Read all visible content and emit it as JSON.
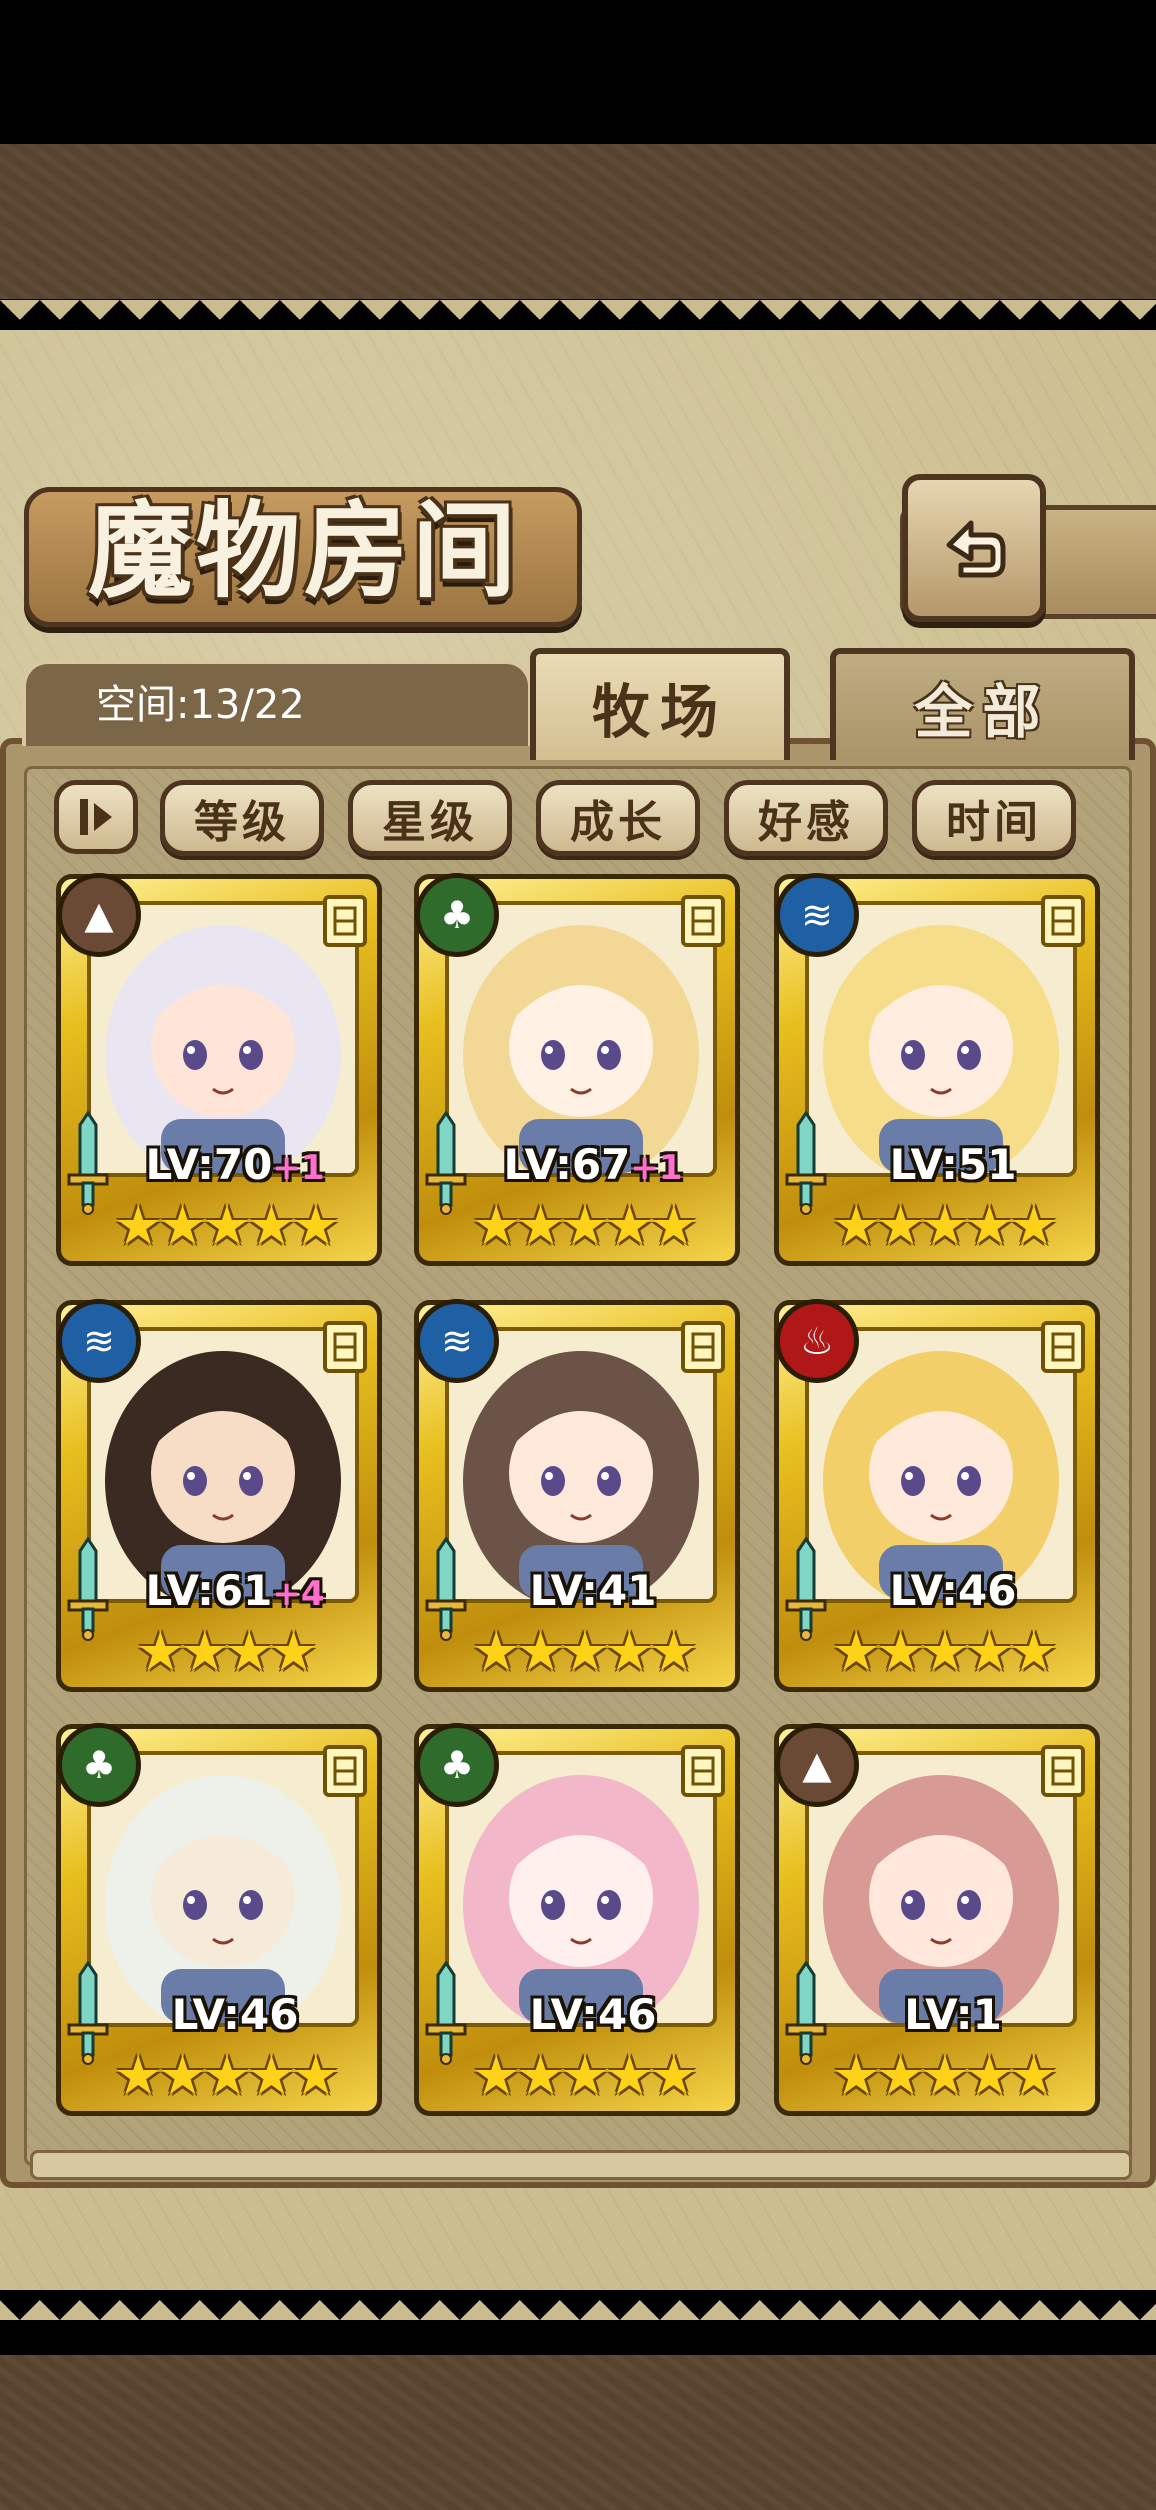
{
  "title": "魔物房间",
  "space_label": "空间:13/22",
  "tabs": [
    {
      "label": "牧场",
      "active": true
    },
    {
      "label": "全部",
      "active": false
    }
  ],
  "sort_buttons": [
    "等级",
    "星级",
    "成长",
    "好感",
    "时间"
  ],
  "colors": {
    "earth": "#6b4a35",
    "grass": "#2f6b2a",
    "water": "#1f5fa3",
    "fire": "#b01717"
  },
  "cards": [
    {
      "element": "earth",
      "level": "LV:70",
      "bonus": "+1",
      "stars": "★★★★★",
      "hair": "#e9e6f2",
      "skin": "#ffe5d8"
    },
    {
      "element": "grass",
      "level": "LV:67",
      "bonus": "+1",
      "stars": "★★★★★",
      "hair": "#f3d795",
      "skin": "#fff1e4"
    },
    {
      "element": "water",
      "level": "LV:51",
      "bonus": "",
      "stars": "★★★★★",
      "hair": "#f6dd8a",
      "skin": "#ffeee0"
    },
    {
      "element": "water",
      "level": "LV:61",
      "bonus": "+4",
      "stars": "★★★★",
      "hair": "#3b2a22",
      "skin": "#f7dcc6"
    },
    {
      "element": "water",
      "level": "LV:41",
      "bonus": "",
      "stars": "★★★★★",
      "hair": "#6b5447",
      "skin": "#ffe9da"
    },
    {
      "element": "fire",
      "level": "LV:46",
      "bonus": "",
      "stars": "★★★★★",
      "hair": "#f3cf6a",
      "skin": "#ffe9da"
    },
    {
      "element": "grass",
      "level": "LV:46",
      "bonus": "",
      "stars": "★★★★★",
      "hair": "#eef0ea",
      "skin": "#f6ead8"
    },
    {
      "element": "grass",
      "level": "LV:46",
      "bonus": "",
      "stars": "★★★★★",
      "hair": "#f2b7c8",
      "skin": "#fff0ee"
    },
    {
      "element": "earth",
      "level": "LV:1",
      "bonus": "",
      "stars": "★★★★★",
      "hair": "#d89a94",
      "skin": "#ffe7dc"
    }
  ]
}
